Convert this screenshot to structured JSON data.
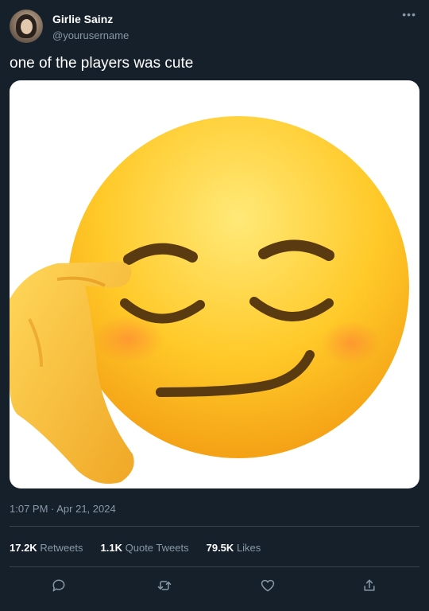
{
  "user": {
    "display_name": "Girlie Sainz",
    "handle": "@yourusername"
  },
  "tweet": {
    "text": "one of the players was cute",
    "media_alt": "smirking face emoji with hand on forehead",
    "timestamp": "1:07 PM · Apr 21, 2024"
  },
  "stats": {
    "retweets_count": "17.2K",
    "retweets_label": "Retweets",
    "quote_tweets_count": "1.1K",
    "quote_tweets_label": "Quote Tweets",
    "likes_count": "79.5K",
    "likes_label": "Likes"
  },
  "icons": {
    "more": "more-icon",
    "reply": "reply-icon",
    "retweet": "retweet-icon",
    "like": "heart-icon",
    "share": "share-icon"
  },
  "colors": {
    "background": "#15202b",
    "text": "#ffffff",
    "muted": "#8899a6",
    "divider": "#38444d"
  }
}
